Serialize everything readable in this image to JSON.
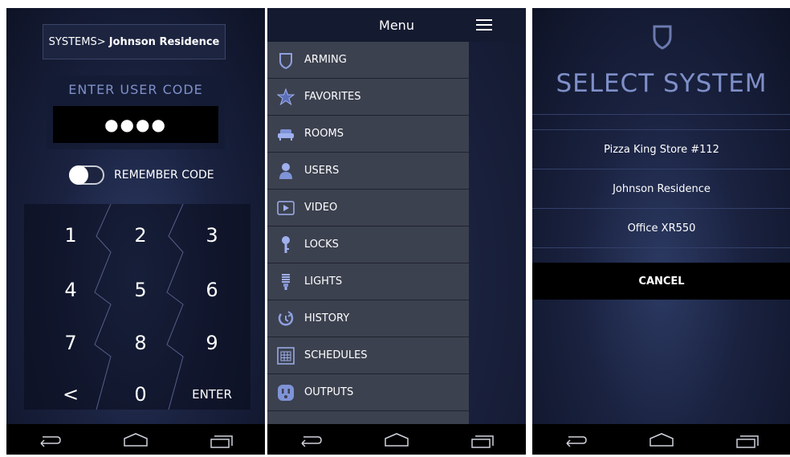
{
  "screen1": {
    "system_prefix": "SYSTEMS> ",
    "system_name": "Johnson Residence",
    "code_title": "ENTER USER CODE",
    "code_value": "●●●●",
    "remember_label": "REMEMBER CODE",
    "remember_on": false,
    "keys": [
      "1",
      "2",
      "3",
      "4",
      "5",
      "6",
      "7",
      "8",
      "9",
      "<",
      "0",
      "ENTER"
    ]
  },
  "screen2": {
    "title": "Menu",
    "items": [
      {
        "label": "ARMING",
        "icon": "shield-icon"
      },
      {
        "label": "FAVORITES",
        "icon": "star-icon"
      },
      {
        "label": "ROOMS",
        "icon": "sofa-icon"
      },
      {
        "label": "USERS",
        "icon": "user-icon"
      },
      {
        "label": "VIDEO",
        "icon": "play-icon"
      },
      {
        "label": "LOCKS",
        "icon": "key-icon"
      },
      {
        "label": "LIGHTS",
        "icon": "bulb-icon"
      },
      {
        "label": "HISTORY",
        "icon": "history-icon"
      },
      {
        "label": "SCHEDULES",
        "icon": "calendar-icon"
      },
      {
        "label": "OUTPUTS",
        "icon": "outlet-icon"
      }
    ]
  },
  "screen3": {
    "title": "SELECT SYSTEM",
    "systems": [
      "Pizza King Store #112",
      "Johnson Residence",
      "Office XR550"
    ],
    "cancel_label": "CANCEL"
  },
  "colors": {
    "accent": "#7f8fc9",
    "menu_bg": "#3c414f",
    "nav_bg": "#000000"
  }
}
